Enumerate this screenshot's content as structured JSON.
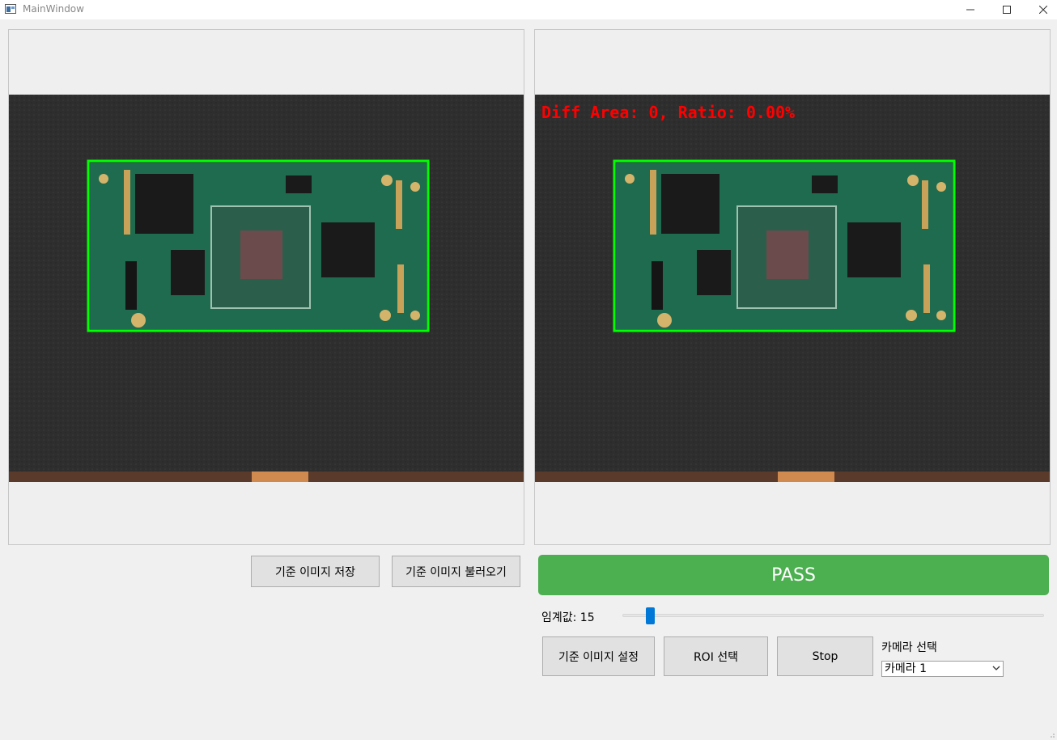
{
  "window": {
    "title": "MainWindow",
    "minimize_icon": "minimize-icon",
    "maximize_icon": "maximize-icon",
    "close_icon": "close-icon"
  },
  "reference_view": {
    "content": "camera-frame-pcb",
    "roi_color": "#00ff00"
  },
  "live_view": {
    "overlay_text": "Diff Area: 0, Ratio: 0.00%",
    "overlay_color": "#ff0000",
    "roi_color": "#00ff00"
  },
  "buttons": {
    "save_reference": "기준 이미지 저장",
    "load_reference": "기준 이미지 불러오기",
    "set_reference": "기준 이미지 설정",
    "roi_select": "ROI 선택",
    "stop": "Stop"
  },
  "result": {
    "status": "PASS",
    "color": "#4caf50"
  },
  "threshold": {
    "label": "임계값: 15",
    "value": 15
  },
  "camera": {
    "label": "카메라 선택",
    "selected": "카메라 1"
  }
}
